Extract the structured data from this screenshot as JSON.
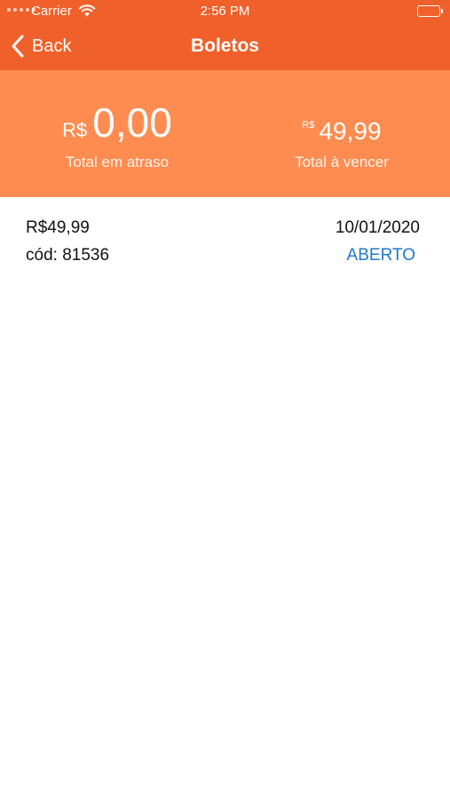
{
  "status_bar": {
    "carrier": "Carrier",
    "time": "2:56 PM"
  },
  "nav": {
    "back_label": "Back",
    "title": "Boletos"
  },
  "summary": {
    "overdue": {
      "currency": "R$",
      "value": "0,00",
      "caption": "Total em atraso"
    },
    "upcoming": {
      "currency": "R$",
      "value": "49,99",
      "caption": "Total à vencer"
    }
  },
  "boletos": [
    {
      "amount": "R$49,99",
      "code": "cód: 81536",
      "due_date": "10/01/2020",
      "status": "ABERTO"
    }
  ],
  "colors": {
    "header": "#f0602a",
    "summary_band": "#fe8c50",
    "status_open": "#1e79c8"
  },
  "icons": {
    "back": "chevron-left-icon",
    "wifi": "wifi-icon",
    "battery": "battery-icon"
  }
}
